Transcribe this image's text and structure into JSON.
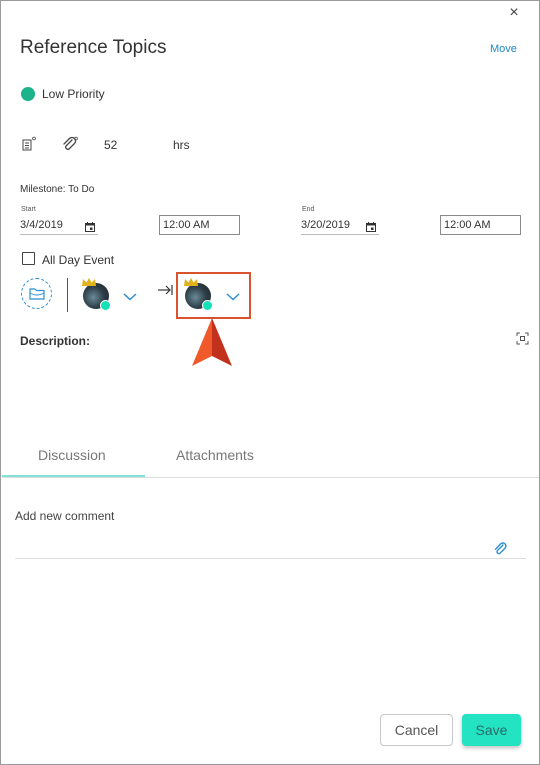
{
  "dialog": {
    "close_glyph": "×",
    "title": "Reference Topics",
    "move_label": "Move"
  },
  "priority": {
    "label": "Low Priority",
    "color": "#1bb38a"
  },
  "stats": {
    "icons": [
      "notes-icon",
      "attachment-icon"
    ],
    "hours_value": "52",
    "hours_unit": "hrs"
  },
  "schedule": {
    "milestone": "Milestone: To Do",
    "start_label": "Start",
    "start_date": "3/4/2019",
    "start_time": "12:00 AM",
    "end_label": "End",
    "end_date": "3/20/2019",
    "end_time": "12:00 AM",
    "all_day_label": "All Day Event",
    "all_day_checked": false
  },
  "assignees": {
    "from_status_color": "#13e1b6",
    "to_status_color": "#13e1b6"
  },
  "description": {
    "label": "Description:"
  },
  "tabs": [
    {
      "label": "Discussion",
      "active": true
    },
    {
      "label": "Attachments",
      "active": false
    }
  ],
  "comment": {
    "placeholder": "Add new comment"
  },
  "footer": {
    "cancel_label": "Cancel",
    "save_label": "Save",
    "save_color": "#23e3c3"
  },
  "colors": {
    "accent": "#2c8fd1",
    "highlight": "#d9532f"
  }
}
